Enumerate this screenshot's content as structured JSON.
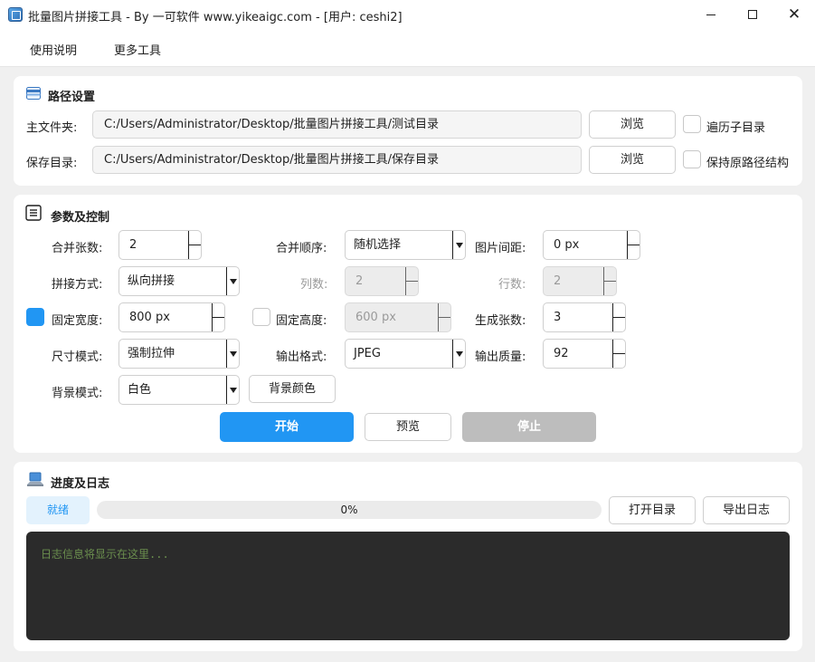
{
  "window": {
    "title": "批量图片拼接工具 - By 一可软件 www.yikeaigc.com - [用户: ceshi2]",
    "minimize": "minimize",
    "maximize": "maximize",
    "close": "✕"
  },
  "menu": {
    "items": [
      "使用说明",
      "更多工具"
    ]
  },
  "path_section": {
    "title": "路径设置",
    "main_folder_label": "主文件夹:",
    "main_folder_value": "C:/Users/Administrator/Desktop/批量图片拼接工具/测试目录",
    "save_dir_label": "保存目录:",
    "save_dir_value": "C:/Users/Administrator/Desktop/批量图片拼接工具/保存目录",
    "browse_label": "浏览",
    "recursive_label": "遍历子目录",
    "recursive_checked": false,
    "keep_structure_label": "保持原路径结构",
    "keep_structure_checked": false
  },
  "params_section": {
    "title": "参数及控制",
    "merge_count_label": "合并张数:",
    "merge_count_value": "2",
    "merge_order_label": "合并顺序:",
    "merge_order_value": "随机选择",
    "spacing_label": "图片间距:",
    "spacing_value": "0 px",
    "join_mode_label": "拼接方式:",
    "join_mode_value": "纵向拼接",
    "columns_label": "列数:",
    "columns_value": "2",
    "rows_label": "行数:",
    "rows_value": "2",
    "fixed_width_label": "固定宽度:",
    "fixed_width_checked": true,
    "fixed_width_value": "800 px",
    "fixed_height_label": "固定高度:",
    "fixed_height_checked": false,
    "fixed_height_value": "600 px",
    "gen_count_label": "生成张数:",
    "gen_count_value": "3",
    "size_mode_label": "尺寸模式:",
    "size_mode_value": "强制拉伸",
    "output_format_label": "输出格式:",
    "output_format_value": "JPEG",
    "quality_label": "输出质量:",
    "quality_value": "92",
    "bg_mode_label": "背景模式:",
    "bg_mode_value": "白色",
    "bg_color_button": "背景颜色",
    "start_button": "开始",
    "preview_button": "预览",
    "stop_button": "停止"
  },
  "log_section": {
    "title": "进度及日志",
    "status": "就绪",
    "progress_percent": 0,
    "progress_text": "0%",
    "open_dir_button": "打开目录",
    "export_log_button": "导出日志",
    "log_placeholder": "日志信息将显示在这里..."
  },
  "colors": {
    "accent": "#2196f3",
    "disabled_button": "#bdbdbd",
    "log_background": "#2b2b2b",
    "log_text": "#6b8f4e"
  }
}
